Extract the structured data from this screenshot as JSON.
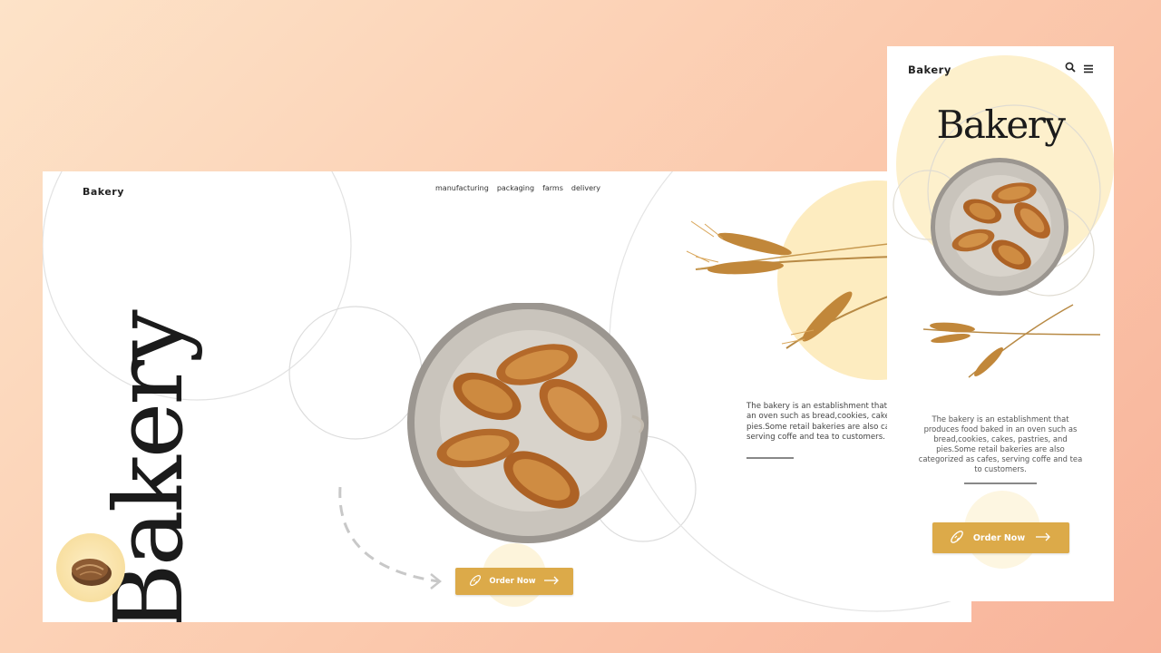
{
  "colors": {
    "accent": "#dcaa49",
    "accent_light": "#fbe8b8",
    "text_dark": "#1b1b1b",
    "background_gradient_start": "#fde3c8",
    "background_gradient_end": "#f8b39a"
  },
  "desktop": {
    "logo": "Bakery",
    "nav": [
      "manufacturing",
      "packaging",
      "farms",
      "delivery"
    ],
    "hero_title": "Bakery",
    "description": "The bakery is an establishment that produces food baked in an oven such as bread,cookies, cakes, pastries, and pies.Some retail bakeries are also categorized as cafes, serving coffe and tea to customers.",
    "cta_label": "Order Now",
    "icons": [
      "bread-loaf-icon",
      "baguette-icon",
      "arrow-right-icon",
      "dashed-arrow-icon",
      "croissant-basket-image",
      "wheat-image"
    ]
  },
  "mobile": {
    "logo": "Bakery",
    "hero_title": "Bakery",
    "description": "The bakery is an establishment that produces food baked in an oven such as bread,cookies, cakes, pastries, and pies.Some retail bakeries are also categorized as cafes, serving coffe and tea to customers.",
    "cta_label": "Order Now",
    "icons": [
      "search-icon",
      "menu-icon",
      "baguette-icon",
      "arrow-right-icon",
      "croissant-basket-image",
      "wheat-image"
    ]
  }
}
